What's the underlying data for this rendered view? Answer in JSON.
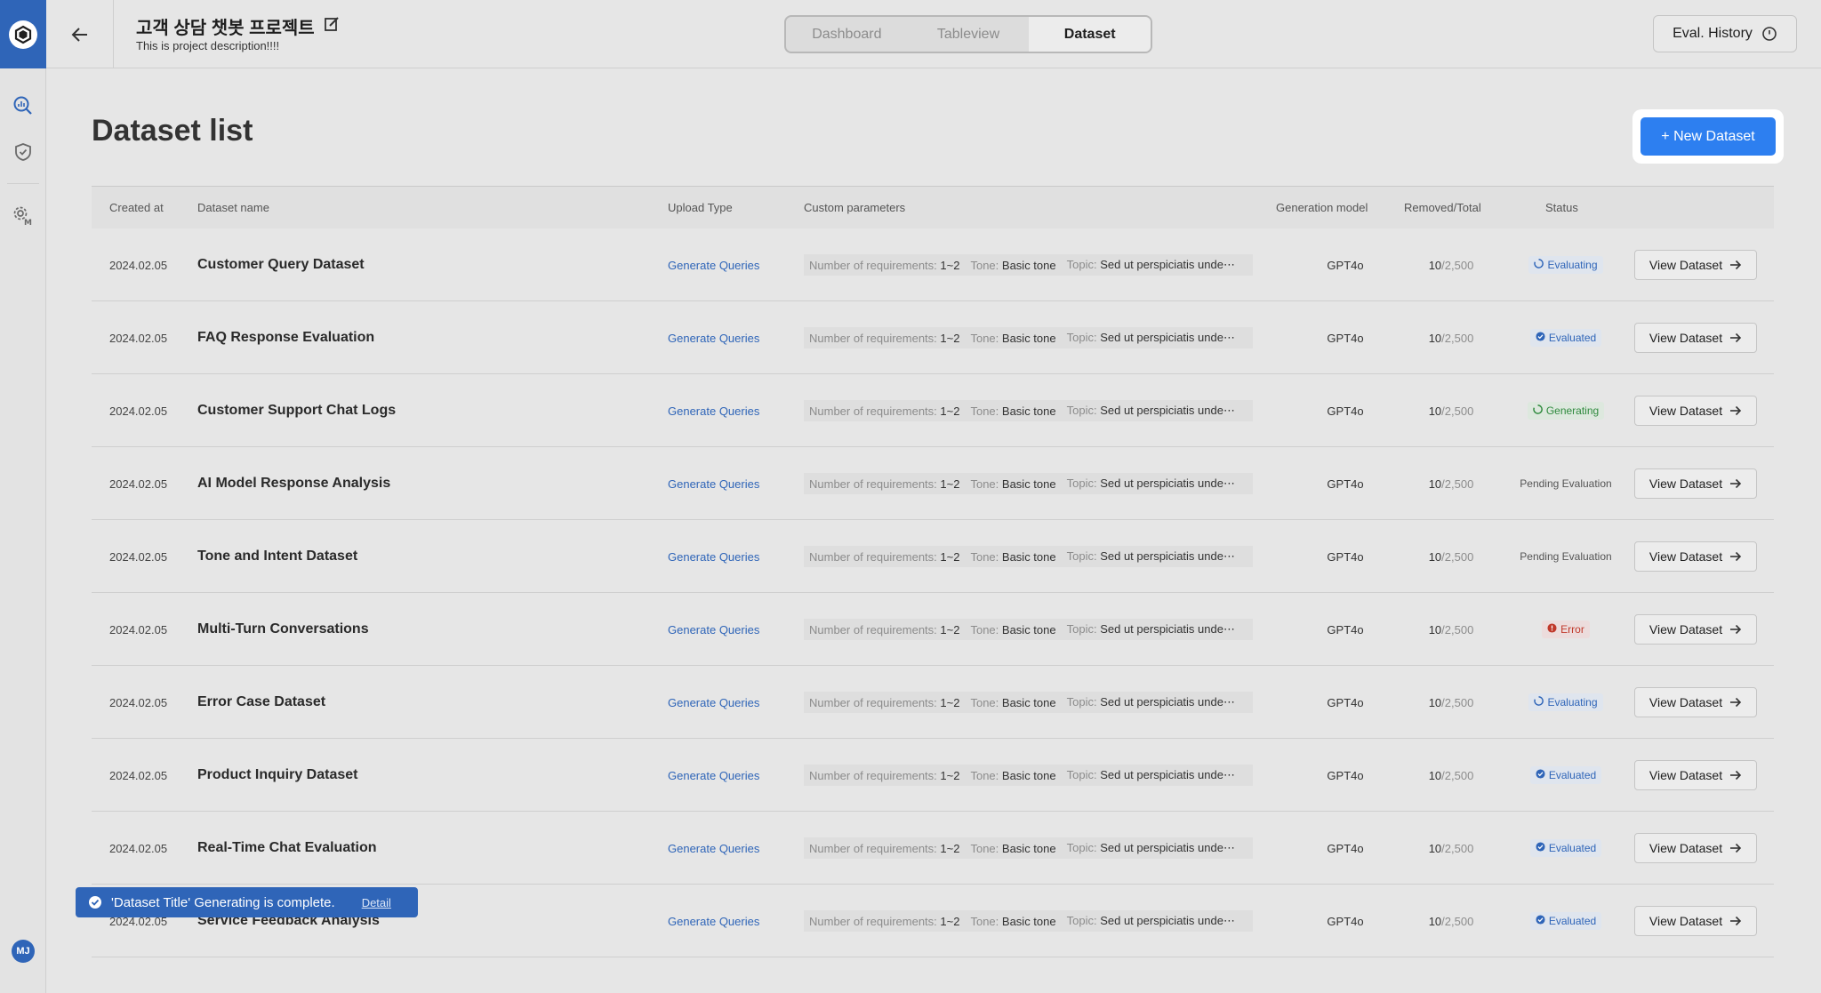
{
  "header": {
    "title": "고객 상담 챗봇 프로젝트",
    "description": "This is project description!!!!",
    "tabs": [
      {
        "label": "Dashboard"
      },
      {
        "label": "Tableview"
      },
      {
        "label": "Dataset"
      }
    ],
    "active_tab": "Dataset",
    "eval_history_label": "Eval. History"
  },
  "sidebar": {
    "avatar_initials": "MJ"
  },
  "main": {
    "title": "Dataset list",
    "new_dataset_label": "+ New Dataset"
  },
  "table": {
    "columns": [
      "Created at",
      "Dataset name",
      "Upload Type",
      "Custom parameters",
      "Generation model",
      "Removed/Total",
      "Status"
    ],
    "param_keys": {
      "req": "Number of requirements:",
      "tone": "Tone:",
      "topic": "Topic:"
    },
    "rows": [
      {
        "date": "2024.02.05",
        "name": "Customer Query Dataset",
        "upload": "Generate Queries",
        "req": "1~2",
        "tone": "Basic tone",
        "topic": "Sed ut perspiciatis unde⋯",
        "model": "GPT4o",
        "removed": "10",
        "total": "/2,500",
        "status": "Evaluating",
        "status_kind": "evaluating",
        "view": "View Dataset"
      },
      {
        "date": "2024.02.05",
        "name": "FAQ Response Evaluation",
        "upload": "Generate Queries",
        "req": "1~2",
        "tone": "Basic tone",
        "topic": "Sed ut perspiciatis unde⋯",
        "model": "GPT4o",
        "removed": "10",
        "total": "/2,500",
        "status": "Evaluated",
        "status_kind": "evaluated",
        "view": "View Dataset"
      },
      {
        "date": "2024.02.05",
        "name": "Customer Support Chat Logs",
        "upload": "Generate Queries",
        "req": "1~2",
        "tone": "Basic tone",
        "topic": "Sed ut perspiciatis unde⋯",
        "model": "GPT4o",
        "removed": "10",
        "total": "/2,500",
        "status": "Generating",
        "status_kind": "generating",
        "view": "View Dataset"
      },
      {
        "date": "2024.02.05",
        "name": "AI Model Response Analysis",
        "upload": "Generate Queries",
        "req": "1~2",
        "tone": "Basic tone",
        "topic": "Sed ut perspiciatis unde⋯",
        "model": "GPT4o",
        "removed": "10",
        "total": "/2,500",
        "status": "Pending Evaluation",
        "status_kind": "pending",
        "view": "View Dataset"
      },
      {
        "date": "2024.02.05",
        "name": "Tone and Intent Dataset",
        "upload": "Generate Queries",
        "req": "1~2",
        "tone": "Basic tone",
        "topic": "Sed ut perspiciatis unde⋯",
        "model": "GPT4o",
        "removed": "10",
        "total": "/2,500",
        "status": "Pending Evaluation",
        "status_kind": "pending",
        "view": "View Dataset"
      },
      {
        "date": "2024.02.05",
        "name": "Multi-Turn Conversations",
        "upload": "Generate Queries",
        "req": "1~2",
        "tone": "Basic tone",
        "topic": "Sed ut perspiciatis unde⋯",
        "model": "GPT4o",
        "removed": "10",
        "total": "/2,500",
        "status": "Error",
        "status_kind": "error",
        "view": "View Dataset"
      },
      {
        "date": "2024.02.05",
        "name": "Error Case Dataset",
        "upload": "Generate Queries",
        "req": "1~2",
        "tone": "Basic tone",
        "topic": "Sed ut perspiciatis unde⋯",
        "model": "GPT4o",
        "removed": "10",
        "total": "/2,500",
        "status": "Evaluating",
        "status_kind": "evaluating",
        "view": "View Dataset"
      },
      {
        "date": "2024.02.05",
        "name": "Product Inquiry Dataset",
        "upload": "Generate Queries",
        "req": "1~2",
        "tone": "Basic tone",
        "topic": "Sed ut perspiciatis unde⋯",
        "model": "GPT4o",
        "removed": "10",
        "total": "/2,500",
        "status": "Evaluated",
        "status_kind": "evaluated",
        "view": "View Dataset"
      },
      {
        "date": "2024.02.05",
        "name": "Real-Time Chat Evaluation",
        "upload": "Generate Queries",
        "req": "1~2",
        "tone": "Basic tone",
        "topic": "Sed ut perspiciatis unde⋯",
        "model": "GPT4o",
        "removed": "10",
        "total": "/2,500",
        "status": "Evaluated",
        "status_kind": "evaluated",
        "view": "View Dataset"
      },
      {
        "date": "2024.02.05",
        "name": "Service Feedback Analysis",
        "upload": "Generate Queries",
        "req": "1~2",
        "tone": "Basic tone",
        "topic": "Sed ut perspiciatis unde⋯",
        "model": "GPT4o",
        "removed": "10",
        "total": "/2,500",
        "status": "Evaluated",
        "status_kind": "evaluated",
        "view": "View Dataset"
      }
    ]
  },
  "toast": {
    "message": "'Dataset Title' Generating is complete.",
    "detail_label": "Detail"
  },
  "colors": {
    "accent": "#2d7ff0",
    "brand": "#2f65b8",
    "error": "#c0392b",
    "success": "#2f8a3e"
  }
}
